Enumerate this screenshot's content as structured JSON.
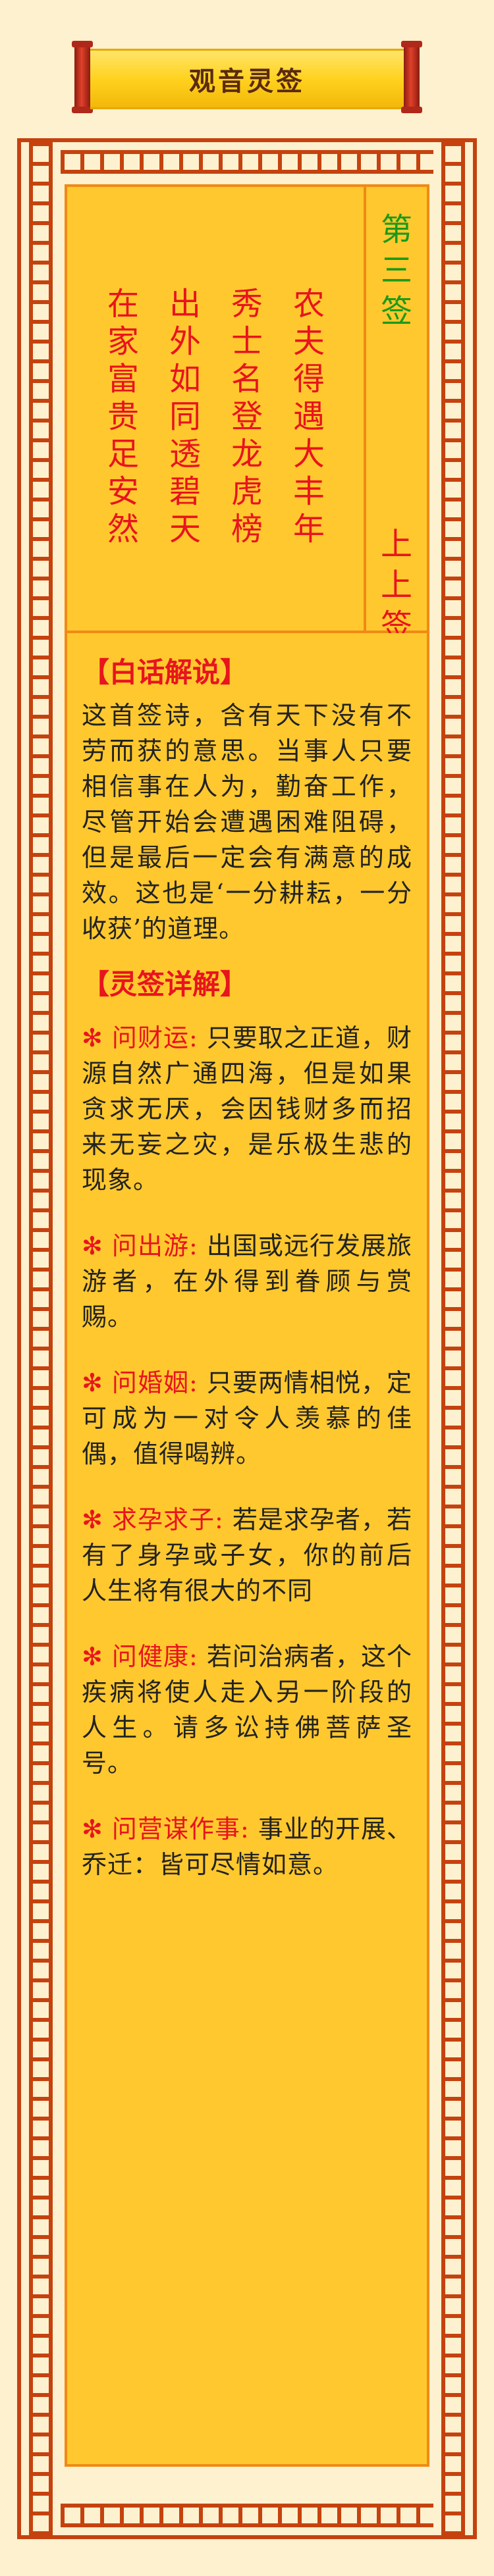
{
  "title": "观音灵签",
  "poem": {
    "columns": [
      "农夫得遇大丰年",
      "秀士名登龙虎榜",
      "出外如同透碧天",
      "在家富贵足安然"
    ]
  },
  "sign": {
    "number_chars": [
      "第",
      "三",
      "签"
    ],
    "grade_chars": [
      "上",
      "上",
      "签"
    ]
  },
  "explanation": {
    "heading": "【白话解说】",
    "text": "这首签诗，含有天下没有不劳而获的意思。当事人只要相信事在人为，勤奋工作，尽管开始会遭遇困难阻碍，但是最后一定会有满意的成效。这也是‘一分耕耘，一分收获’的道理。"
  },
  "details": {
    "heading": "【灵签详解】",
    "bullet": "✻",
    "items": [
      {
        "label": "问财运:",
        "text": "只要取之正道，财源自然广通四海，但是如果贪求无厌，会因钱财多而招来无妄之灾，是乐极生悲的现象。"
      },
      {
        "label": "问出游:",
        "text": "出国或远行发展旅游者，在外得到眷顾与赏赐。"
      },
      {
        "label": "问婚姻:",
        "text": "只要两情相悦，定可成为一对令人羡慕的佳偶，值得喝辨。"
      },
      {
        "label": "求孕求子:",
        "text": "若是求孕者，若有了身孕或子女，你的前后人生将有很大的不同"
      },
      {
        "label": "问健康:",
        "text": "若问治病者，这个疾病将使人走入另一阶段的人生。请多讼持佛菩萨圣号。"
      },
      {
        "label": "问营谋作事:",
        "text": "事业的开展、乔迁：皆可尽情如意。"
      }
    ]
  },
  "colors": {
    "border": "#c5420f",
    "panel": "#ffc82e",
    "accent_red": "#e8141e",
    "accent_green": "#1a9a1a",
    "background": "#fdf1cf"
  }
}
